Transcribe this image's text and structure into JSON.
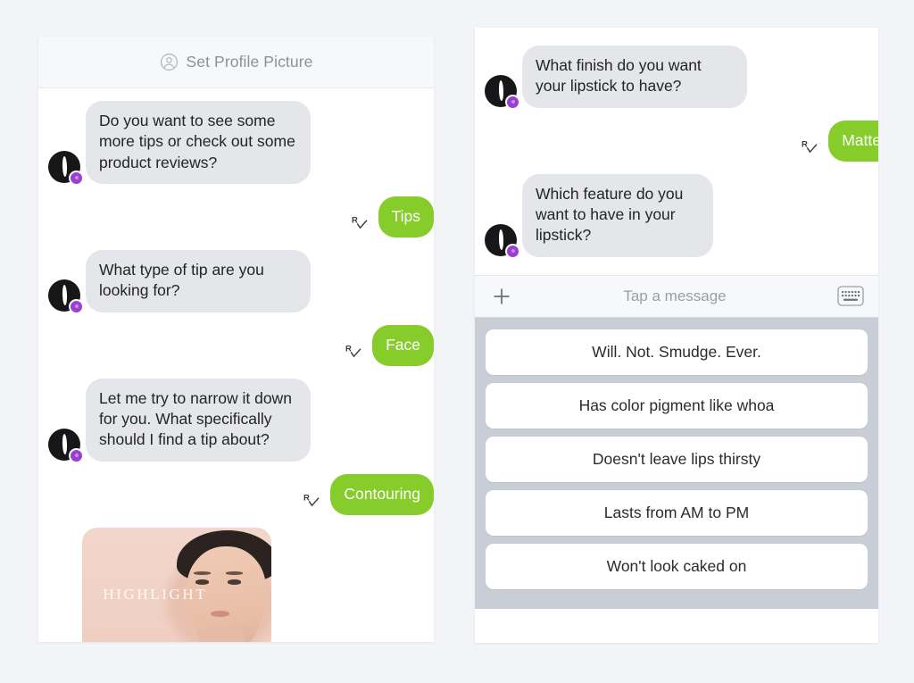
{
  "left_panel": {
    "header": {
      "icon": "profile-circle-icon",
      "label": "Set Profile Picture"
    },
    "messages": [
      {
        "sender": "bot",
        "text": "Do you want to see some more tips or check out some product reviews?"
      },
      {
        "sender": "user",
        "text": "Tips",
        "receipt": "R"
      },
      {
        "sender": "bot",
        "text": "What type of tip are you looking for?"
      },
      {
        "sender": "user",
        "text": "Face",
        "receipt": "R"
      },
      {
        "sender": "bot",
        "text": "Let me try to narrow it down for you. What specifically should I find a tip about?"
      },
      {
        "sender": "user",
        "text": "Contouring",
        "receipt": "R"
      }
    ],
    "attachment_card": {
      "caption": "HIGHLIGHT",
      "alt": "portrait of a woman on a blush pink background"
    }
  },
  "right_panel": {
    "messages": [
      {
        "sender": "bot",
        "text": "What finish do you want your lipstick to have?"
      },
      {
        "sender": "user",
        "text": "Matte",
        "receipt": "R"
      },
      {
        "sender": "bot",
        "text": "Which feature do you want to have in your lipstick?"
      }
    ],
    "composer": {
      "add_icon": "plus-icon",
      "placeholder": "Tap a message",
      "keyboard_icon": "keyboard-icon"
    },
    "quick_replies": [
      "Will. Not. Smudge. Ever.",
      "Has color pigment like whoa",
      "Doesn't leave lips thirsty",
      "Lasts from AM to PM",
      "Won't look caked on"
    ]
  },
  "colors": {
    "page_background": "#f2f4f7",
    "bot_bubble": "#e4e6e9",
    "user_bubble": "#86cc2b",
    "quick_reply_tray": "#c9ced6",
    "avatar_badge": "#9b3fd1",
    "header_text": "#8c9196"
  }
}
